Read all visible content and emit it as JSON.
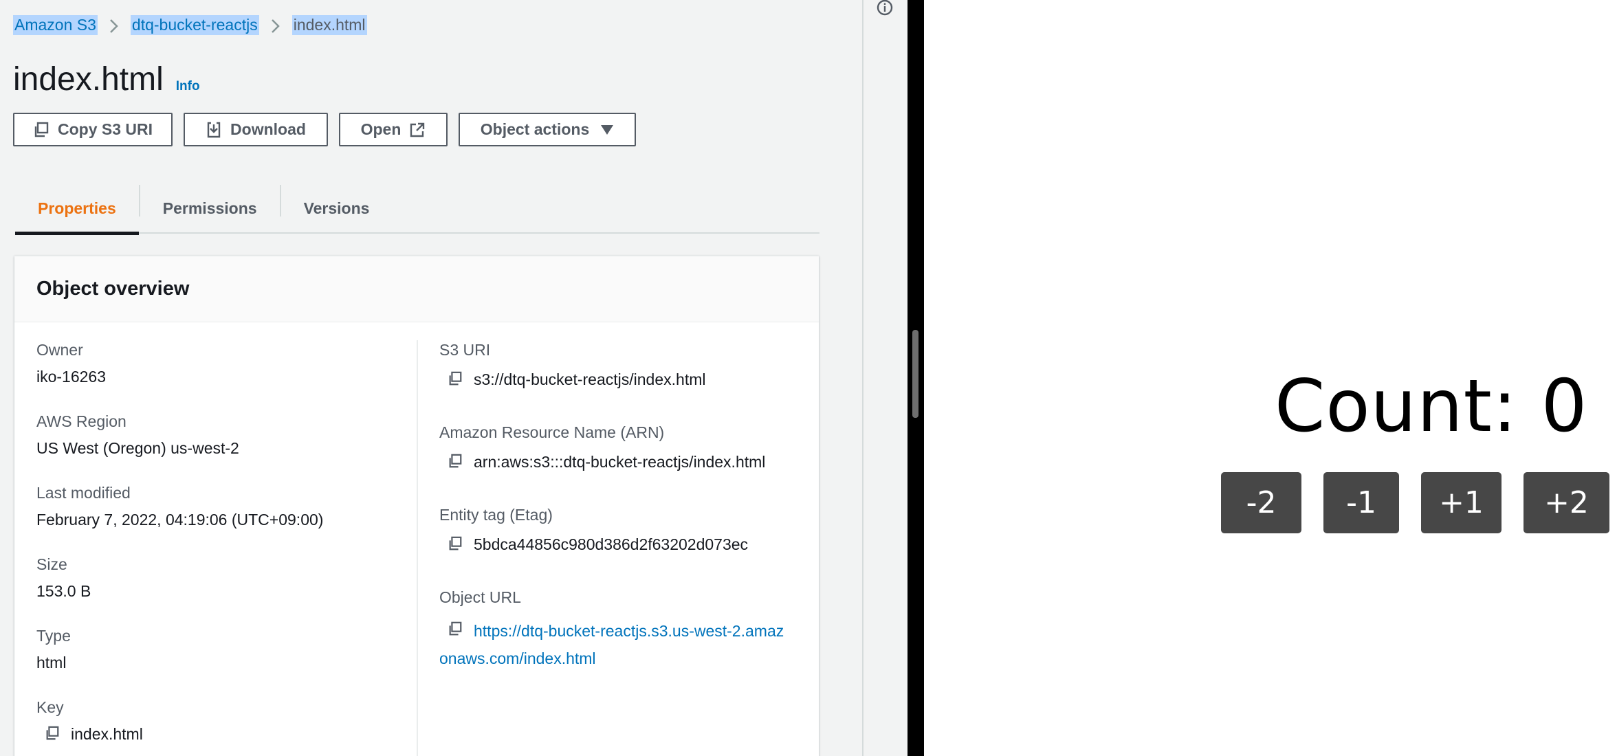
{
  "breadcrumb": {
    "items": [
      "Amazon S3",
      "dtq-bucket-reactjs",
      "index.html"
    ]
  },
  "header": {
    "title": "index.html",
    "info_label": "Info"
  },
  "actions": {
    "copy_uri": "Copy S3 URI",
    "download": "Download",
    "open": "Open",
    "object_actions": "Object actions"
  },
  "tabs": [
    {
      "label": "Properties",
      "active": true
    },
    {
      "label": "Permissions",
      "active": false
    },
    {
      "label": "Versions",
      "active": false
    }
  ],
  "overview": {
    "title": "Object overview",
    "owner": {
      "label": "Owner",
      "value": "iko-16263"
    },
    "region": {
      "label": "AWS Region",
      "value": "US West (Oregon) us-west-2"
    },
    "modified": {
      "label": "Last modified",
      "value": "February 7, 2022, 04:19:06 (UTC+09:00)"
    },
    "size": {
      "label": "Size",
      "value": "153.0 B"
    },
    "type": {
      "label": "Type",
      "value": "html"
    },
    "key": {
      "label": "Key",
      "value": "index.html"
    },
    "s3_uri": {
      "label": "S3 URI",
      "value": "s3://dtq-bucket-reactjs/index.html"
    },
    "arn": {
      "label": "Amazon Resource Name (ARN)",
      "value": "arn:aws:s3:::dtq-bucket-reactjs/index.html"
    },
    "etag": {
      "label": "Entity tag (Etag)",
      "value": "5bdca44856c980d386d2f63202d073ec"
    },
    "url": {
      "label": "Object URL",
      "line1": "https://dtq-bucket-reactjs.s3.us-west-2.amaz",
      "line2": "onaws.com/index.html"
    }
  },
  "app": {
    "count_text": "Count: 0",
    "buttons": [
      "-2",
      "-1",
      "+1",
      "+2"
    ]
  },
  "colors": {
    "accent_orange": "#ec7211",
    "link_blue": "#0073bb",
    "selection": "#b4d5fe",
    "counter_button": "#474747"
  },
  "icons": [
    "chevron-right-icon",
    "copy-icon",
    "download-icon",
    "external-link-icon",
    "caret-down-icon",
    "info-circle-icon"
  ]
}
